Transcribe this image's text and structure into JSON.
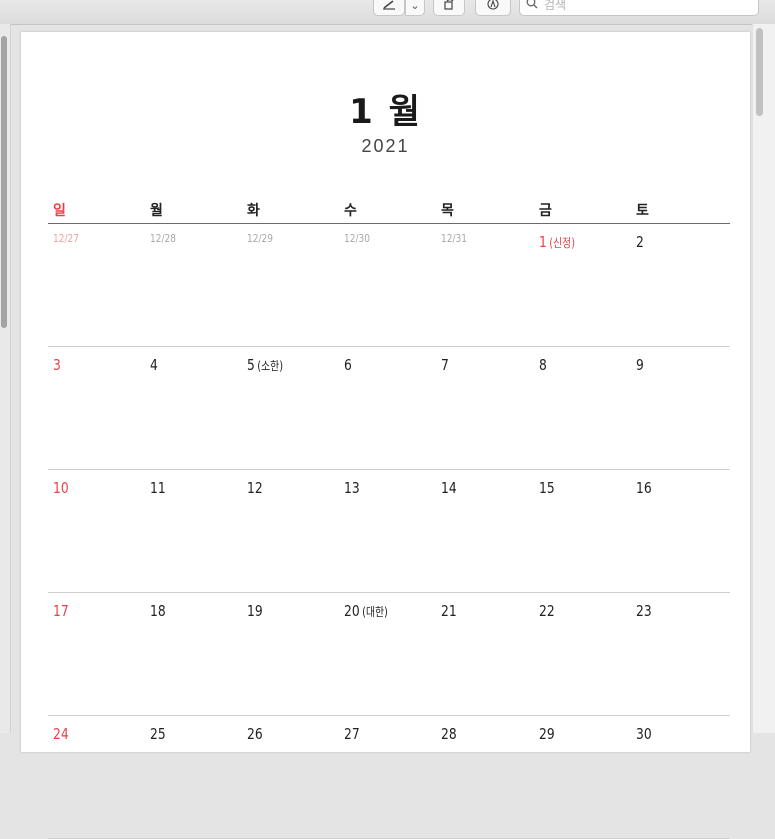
{
  "toolbar": {
    "search_placeholder": "검색",
    "pen_dropdown_glyph": "⌄"
  },
  "calendar": {
    "month_title": "1 월",
    "year": "2021",
    "weekdays": [
      "일",
      "월",
      "화",
      "수",
      "목",
      "금",
      "토"
    ],
    "weeks": [
      [
        {
          "day": "12/27",
          "note": "",
          "type": "prev-sun"
        },
        {
          "day": "12/28",
          "note": "",
          "type": "prev"
        },
        {
          "day": "12/29",
          "note": "",
          "type": "prev"
        },
        {
          "day": "12/30",
          "note": "",
          "type": "prev"
        },
        {
          "day": "12/31",
          "note": "",
          "type": "prev"
        },
        {
          "day": "1",
          "note": "(신정)",
          "type": "holiday"
        },
        {
          "day": "2",
          "note": "",
          "type": "normal"
        }
      ],
      [
        {
          "day": "3",
          "note": "",
          "type": "sun"
        },
        {
          "day": "4",
          "note": "",
          "type": "normal"
        },
        {
          "day": "5",
          "note": "(소한)",
          "type": "normal"
        },
        {
          "day": "6",
          "note": "",
          "type": "normal"
        },
        {
          "day": "7",
          "note": "",
          "type": "normal"
        },
        {
          "day": "8",
          "note": "",
          "type": "normal"
        },
        {
          "day": "9",
          "note": "",
          "type": "normal"
        }
      ],
      [
        {
          "day": "10",
          "note": "",
          "type": "sun"
        },
        {
          "day": "11",
          "note": "",
          "type": "normal"
        },
        {
          "day": "12",
          "note": "",
          "type": "normal"
        },
        {
          "day": "13",
          "note": "",
          "type": "normal"
        },
        {
          "day": "14",
          "note": "",
          "type": "normal"
        },
        {
          "day": "15",
          "note": "",
          "type": "normal"
        },
        {
          "day": "16",
          "note": "",
          "type": "normal"
        }
      ],
      [
        {
          "day": "17",
          "note": "",
          "type": "sun"
        },
        {
          "day": "18",
          "note": "",
          "type": "normal"
        },
        {
          "day": "19",
          "note": "",
          "type": "normal"
        },
        {
          "day": "20",
          "note": "(대한)",
          "type": "normal"
        },
        {
          "day": "21",
          "note": "",
          "type": "normal"
        },
        {
          "day": "22",
          "note": "",
          "type": "normal"
        },
        {
          "day": "23",
          "note": "",
          "type": "normal"
        }
      ],
      [
        {
          "day": "24",
          "note": "",
          "type": "sun"
        },
        {
          "day": "25",
          "note": "",
          "type": "normal"
        },
        {
          "day": "26",
          "note": "",
          "type": "normal"
        },
        {
          "day": "27",
          "note": "",
          "type": "normal"
        },
        {
          "day": "28",
          "note": "",
          "type": "normal"
        },
        {
          "day": "29",
          "note": "",
          "type": "normal"
        },
        {
          "day": "30",
          "note": "",
          "type": "normal"
        }
      ]
    ]
  },
  "colors": {
    "sunday_red": "#e8404a",
    "muted_gray": "#a8a8a8"
  }
}
